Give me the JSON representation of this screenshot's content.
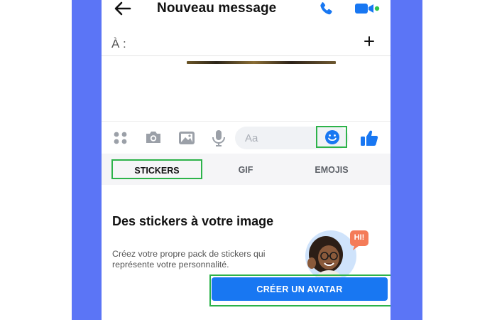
{
  "header": {
    "title": "Nouveau message",
    "back_icon": "arrow-left-icon",
    "call_icon": "phone-icon",
    "video_icon": "video-camera-icon"
  },
  "recipient": {
    "label": "À :",
    "add_icon": "plus-icon"
  },
  "composer": {
    "placeholder": "Aa",
    "icons": [
      "apps-icon",
      "camera-icon",
      "image-icon",
      "microphone-icon",
      "emoji-icon",
      "like-icon"
    ]
  },
  "tabs": [
    {
      "label": "STICKERS",
      "selected": true
    },
    {
      "label": "GIF",
      "selected": false
    },
    {
      "label": "EMOJIS",
      "selected": false
    }
  ],
  "promo": {
    "title": "Des stickers à votre image",
    "description": "Créez votre propre pack de stickers qui représente votre personnalité.",
    "button_label": "CRÉER UN AVATAR",
    "avatar_bubble": "HI!"
  },
  "colors": {
    "accent": "#1877f2",
    "highlight": "#2db34a",
    "side_panel": "#5b75f6"
  }
}
